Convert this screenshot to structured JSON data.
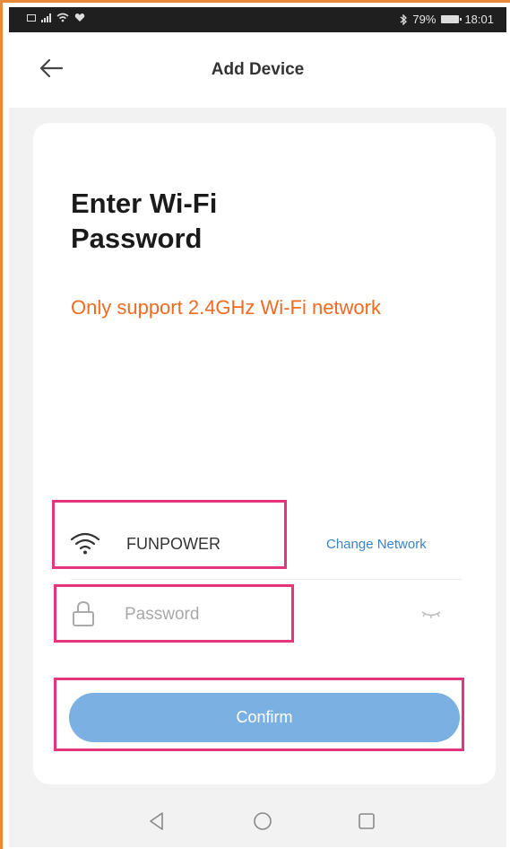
{
  "status_bar": {
    "battery": "79%",
    "time": "18:01"
  },
  "header": {
    "title": "Add Device",
    "back_icon": "arrow-left-icon"
  },
  "card": {
    "title": "Enter Wi-Fi Password",
    "subtitle": "Only support 2.4GHz Wi-Fi network"
  },
  "network": {
    "icon": "wifi-icon",
    "ssid": "FUNPOWER",
    "change_label": "Change Network"
  },
  "password": {
    "icon": "lock-icon",
    "placeholder": "Password",
    "value": "",
    "toggle_icon": "eye-closed-icon"
  },
  "confirm": {
    "label": "Confirm"
  },
  "nav": {
    "back_icon": "nav-back-triangle-icon",
    "home_icon": "nav-home-circle-icon",
    "recent_icon": "nav-recent-square-icon"
  },
  "colors": {
    "accent_orange": "#ee6b22",
    "link_blue": "#3b84c6",
    "button_blue": "#7bb0e2",
    "highlight_pink": "#e5357c"
  }
}
